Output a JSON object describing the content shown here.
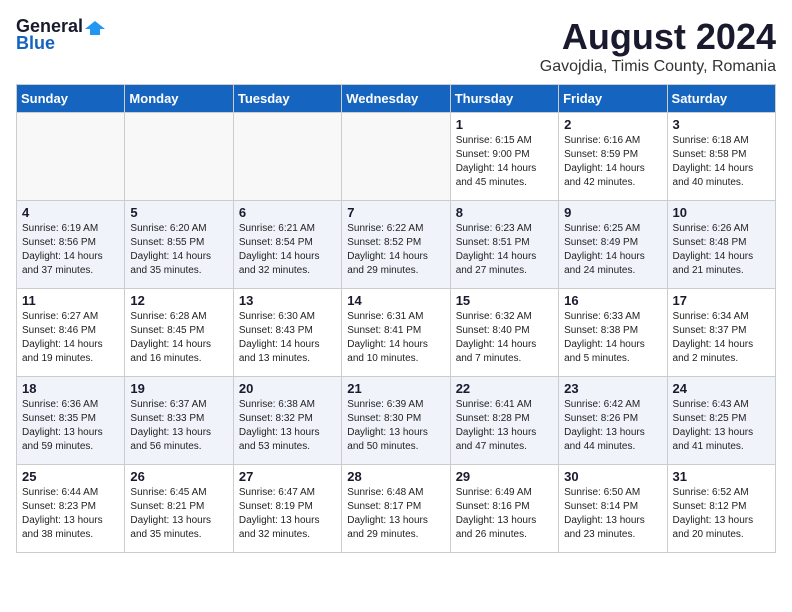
{
  "header": {
    "logo_general": "General",
    "logo_blue": "Blue",
    "title": "August 2024",
    "subtitle": "Gavojdia, Timis County, Romania"
  },
  "days_of_week": [
    "Sunday",
    "Monday",
    "Tuesday",
    "Wednesday",
    "Thursday",
    "Friday",
    "Saturday"
  ],
  "weeks": [
    [
      {
        "day": "",
        "info": ""
      },
      {
        "day": "",
        "info": ""
      },
      {
        "day": "",
        "info": ""
      },
      {
        "day": "",
        "info": ""
      },
      {
        "day": "1",
        "info": "Sunrise: 6:15 AM\nSunset: 9:00 PM\nDaylight: 14 hours\nand 45 minutes."
      },
      {
        "day": "2",
        "info": "Sunrise: 6:16 AM\nSunset: 8:59 PM\nDaylight: 14 hours\nand 42 minutes."
      },
      {
        "day": "3",
        "info": "Sunrise: 6:18 AM\nSunset: 8:58 PM\nDaylight: 14 hours\nand 40 minutes."
      }
    ],
    [
      {
        "day": "4",
        "info": "Sunrise: 6:19 AM\nSunset: 8:56 PM\nDaylight: 14 hours\nand 37 minutes."
      },
      {
        "day": "5",
        "info": "Sunrise: 6:20 AM\nSunset: 8:55 PM\nDaylight: 14 hours\nand 35 minutes."
      },
      {
        "day": "6",
        "info": "Sunrise: 6:21 AM\nSunset: 8:54 PM\nDaylight: 14 hours\nand 32 minutes."
      },
      {
        "day": "7",
        "info": "Sunrise: 6:22 AM\nSunset: 8:52 PM\nDaylight: 14 hours\nand 29 minutes."
      },
      {
        "day": "8",
        "info": "Sunrise: 6:23 AM\nSunset: 8:51 PM\nDaylight: 14 hours\nand 27 minutes."
      },
      {
        "day": "9",
        "info": "Sunrise: 6:25 AM\nSunset: 8:49 PM\nDaylight: 14 hours\nand 24 minutes."
      },
      {
        "day": "10",
        "info": "Sunrise: 6:26 AM\nSunset: 8:48 PM\nDaylight: 14 hours\nand 21 minutes."
      }
    ],
    [
      {
        "day": "11",
        "info": "Sunrise: 6:27 AM\nSunset: 8:46 PM\nDaylight: 14 hours\nand 19 minutes."
      },
      {
        "day": "12",
        "info": "Sunrise: 6:28 AM\nSunset: 8:45 PM\nDaylight: 14 hours\nand 16 minutes."
      },
      {
        "day": "13",
        "info": "Sunrise: 6:30 AM\nSunset: 8:43 PM\nDaylight: 14 hours\nand 13 minutes."
      },
      {
        "day": "14",
        "info": "Sunrise: 6:31 AM\nSunset: 8:41 PM\nDaylight: 14 hours\nand 10 minutes."
      },
      {
        "day": "15",
        "info": "Sunrise: 6:32 AM\nSunset: 8:40 PM\nDaylight: 14 hours\nand 7 minutes."
      },
      {
        "day": "16",
        "info": "Sunrise: 6:33 AM\nSunset: 8:38 PM\nDaylight: 14 hours\nand 5 minutes."
      },
      {
        "day": "17",
        "info": "Sunrise: 6:34 AM\nSunset: 8:37 PM\nDaylight: 14 hours\nand 2 minutes."
      }
    ],
    [
      {
        "day": "18",
        "info": "Sunrise: 6:36 AM\nSunset: 8:35 PM\nDaylight: 13 hours\nand 59 minutes."
      },
      {
        "day": "19",
        "info": "Sunrise: 6:37 AM\nSunset: 8:33 PM\nDaylight: 13 hours\nand 56 minutes."
      },
      {
        "day": "20",
        "info": "Sunrise: 6:38 AM\nSunset: 8:32 PM\nDaylight: 13 hours\nand 53 minutes."
      },
      {
        "day": "21",
        "info": "Sunrise: 6:39 AM\nSunset: 8:30 PM\nDaylight: 13 hours\nand 50 minutes."
      },
      {
        "day": "22",
        "info": "Sunrise: 6:41 AM\nSunset: 8:28 PM\nDaylight: 13 hours\nand 47 minutes."
      },
      {
        "day": "23",
        "info": "Sunrise: 6:42 AM\nSunset: 8:26 PM\nDaylight: 13 hours\nand 44 minutes."
      },
      {
        "day": "24",
        "info": "Sunrise: 6:43 AM\nSunset: 8:25 PM\nDaylight: 13 hours\nand 41 minutes."
      }
    ],
    [
      {
        "day": "25",
        "info": "Sunrise: 6:44 AM\nSunset: 8:23 PM\nDaylight: 13 hours\nand 38 minutes."
      },
      {
        "day": "26",
        "info": "Sunrise: 6:45 AM\nSunset: 8:21 PM\nDaylight: 13 hours\nand 35 minutes."
      },
      {
        "day": "27",
        "info": "Sunrise: 6:47 AM\nSunset: 8:19 PM\nDaylight: 13 hours\nand 32 minutes."
      },
      {
        "day": "28",
        "info": "Sunrise: 6:48 AM\nSunset: 8:17 PM\nDaylight: 13 hours\nand 29 minutes."
      },
      {
        "day": "29",
        "info": "Sunrise: 6:49 AM\nSunset: 8:16 PM\nDaylight: 13 hours\nand 26 minutes."
      },
      {
        "day": "30",
        "info": "Sunrise: 6:50 AM\nSunset: 8:14 PM\nDaylight: 13 hours\nand 23 minutes."
      },
      {
        "day": "31",
        "info": "Sunrise: 6:52 AM\nSunset: 8:12 PM\nDaylight: 13 hours\nand 20 minutes."
      }
    ]
  ]
}
